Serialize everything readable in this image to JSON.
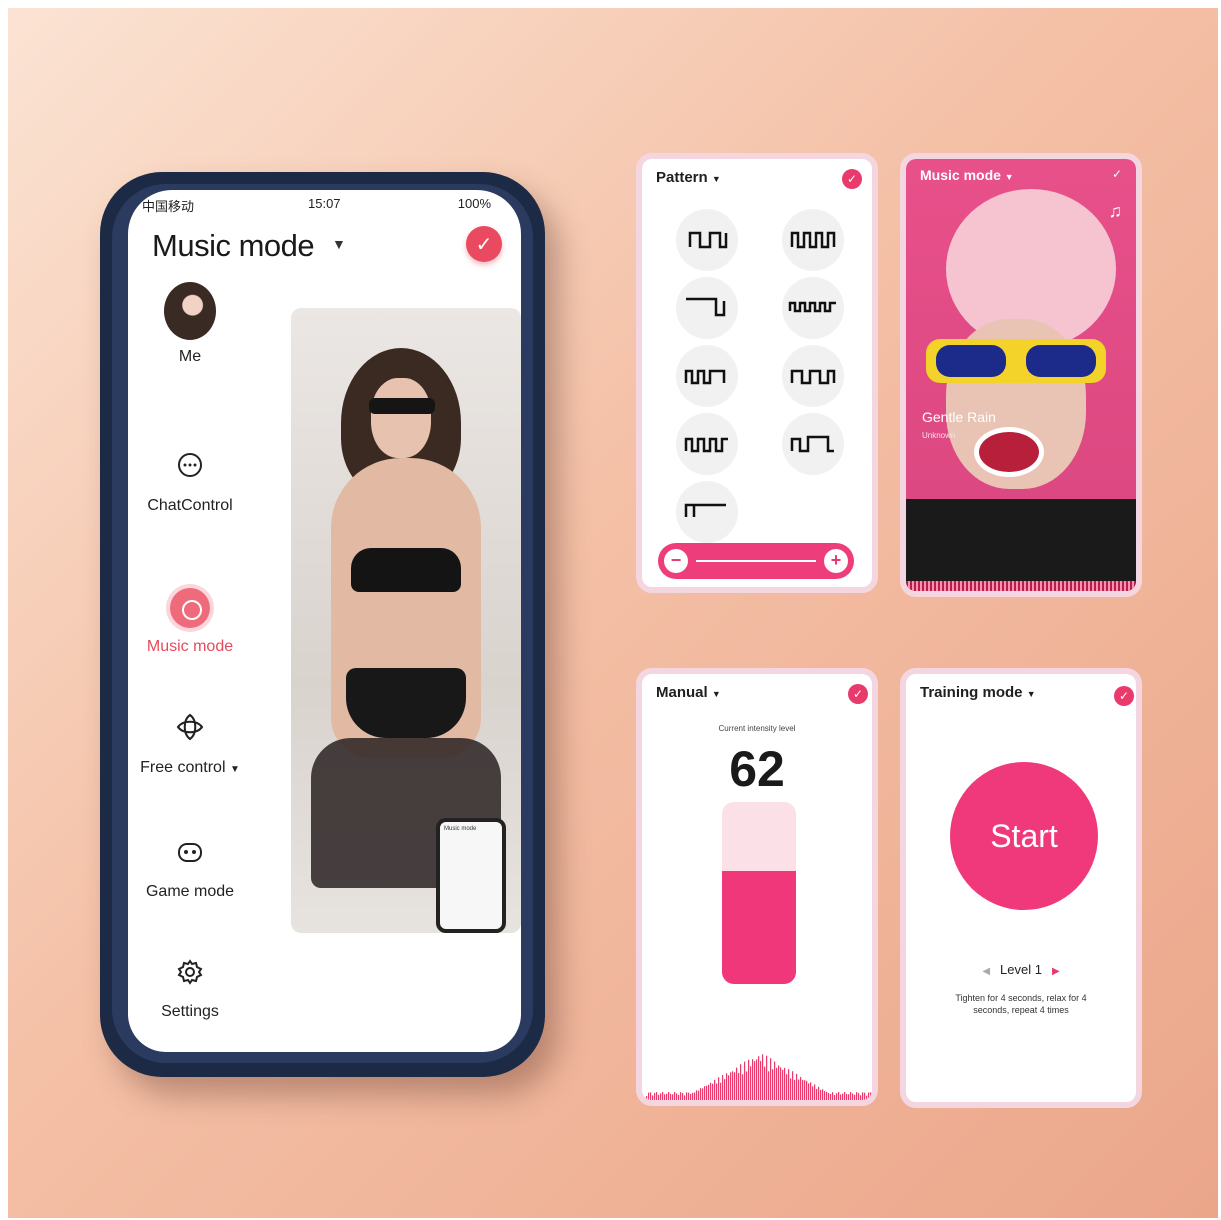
{
  "phone": {
    "status": {
      "carrier": "中国移动",
      "time": "15:07",
      "battery": "100%"
    },
    "title": "Music mode",
    "sidebar": [
      {
        "label": "Me"
      },
      {
        "label": "ChatControl"
      },
      {
        "label": "Music mode",
        "active": true
      },
      {
        "label": "Free control"
      },
      {
        "label": "Game mode"
      },
      {
        "label": "Settings"
      }
    ],
    "mini_phone_title": "Music mode"
  },
  "pattern_card": {
    "title": "Pattern"
  },
  "music_card": {
    "title": "Music mode",
    "song": "Gentle Rain",
    "artist": "Unknown"
  },
  "manual_card": {
    "title": "Manual",
    "intensity_label": "Current intensity level",
    "intensity_value": "62",
    "intensity_fraction": 0.62
  },
  "training_card": {
    "title": "Training mode",
    "start_label": "Start",
    "level": "Level 1",
    "description": "Tighten for 4 seconds, relax for 4 seconds, repeat 4 times"
  },
  "colors": {
    "accent": "#e93a6b",
    "accent_soft": "#fbe0e8",
    "phone_frame": "#1c2a46"
  },
  "icons": [
    "checkmark-icon",
    "chat-icon",
    "music-disc-icon",
    "free-control-icon",
    "gamepad-icon",
    "gear-icon",
    "music-note-icon"
  ]
}
